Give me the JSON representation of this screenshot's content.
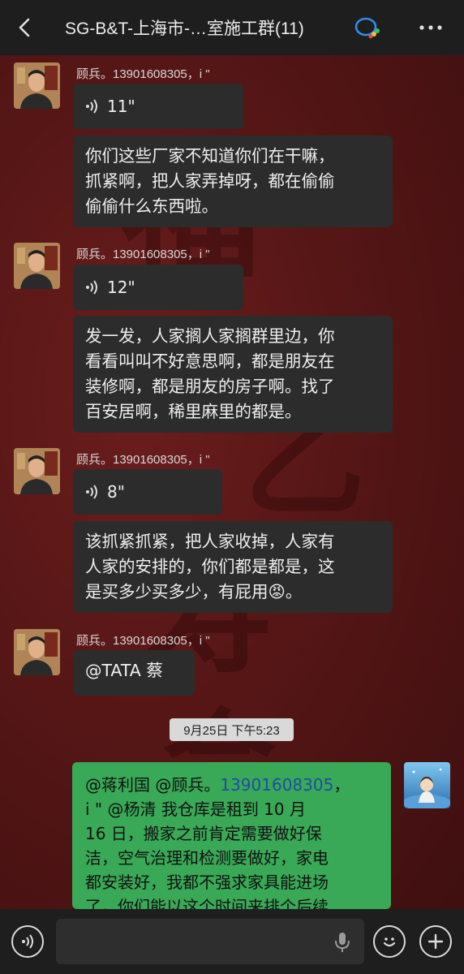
{
  "header": {
    "title": "SG-B&T-上海市-…室施工群(11)"
  },
  "messages": [
    {
      "sender": "顾兵。13901608305，i \"",
      "voice_duration": "11\"",
      "text": [
        "你们这些厂家不知道你们在干嘛，",
        "抓紧啊，把人家弄掉呀，都在偷偷",
        "偷偷什么东西啦。"
      ]
    },
    {
      "sender": "顾兵。13901608305，i \"",
      "voice_duration": "12\"",
      "text": [
        "发一发，人家搁人家搁群里边，你",
        "看看叫叫不好意思啊，都是朋友在",
        "装修啊，都是朋友的房子啊。找了",
        "百安居啊，稀里麻里的都是。"
      ]
    },
    {
      "sender": "顾兵。13901608305，i \"",
      "voice_duration": "8\"",
      "text": [
        "该抓紧抓紧，把人家收掉，人家有",
        "人家的安排的，你们都是都是，这",
        "是买多少买多少，有屁用😡。"
      ]
    },
    {
      "sender": "顾兵。13901608305，i \"",
      "text": [
        "@TATA 蔡"
      ]
    }
  ],
  "timestamp": "9月25日 下午5:23",
  "my_message": {
    "line1_prefix": "@蒋利国  @顾兵。",
    "line1_phone": "13901608305",
    "line1_suffix": "，",
    "lines": [
      "i \"  @杨清  我仓库是租到 10 月",
      "16 日，搬家之前肯定需要做好保",
      "洁，空气治理和检测要做好，家电",
      "都安装好，我都不强求家具能进场",
      "了，你们能以这个时间来排个后续"
    ]
  },
  "colors": {
    "bubble_dark": "#2c2c2c",
    "bubble_green": "#39a857",
    "mention_link": "#1f4ea3"
  }
}
